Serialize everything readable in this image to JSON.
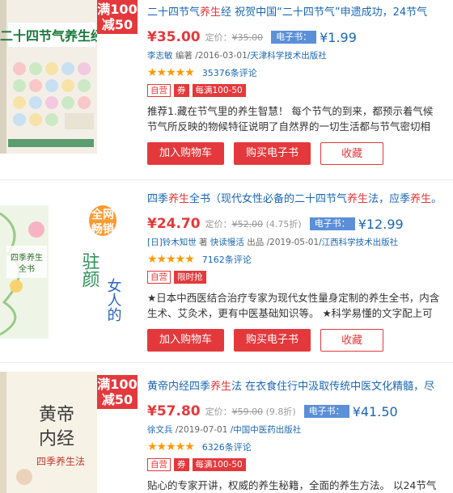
{
  "items": [
    {
      "promo": [
        "满100",
        "减50"
      ],
      "title_parts": [
        "二十四节气",
        "养生",
        "经  祝贺中国“二十四节气”申遗成功，24节气"
      ],
      "price": "¥35.00",
      "orig_label": "定价：",
      "orig_price": "¥35.00",
      "discount": "",
      "ebook_label": "电子书：",
      "ebook_price": "¥1.99",
      "author": "李志敏",
      "role": " 编著 ",
      "date": "/2016-03-01",
      "publisher": "/天津科学技术出版社",
      "stars": "★★★★★",
      "reviews": "35376条评论",
      "tags": [
        "自营",
        "券",
        "每满100-50"
      ],
      "desc": [
        "推荐1.藏在节气里的养生智慧！ 每个节气的到来，都预示着气候",
        "节气所反映的物候特征说明了自然界的一切生活都与节气密切相"
      ],
      "buttons": {
        "cart": "加入购物车",
        "ebook": "购买电子书",
        "fav": "收藏"
      },
      "cover_title": "二十四节气养生经"
    },
    {
      "promo_badge": [
        "全网",
        "畅销"
      ],
      "title_parts": [
        "四季",
        "养生",
        "全书（现代女性必备的二十四节气",
        "养生",
        "法，应季",
        "养生",
        "。"
      ],
      "price": "¥24.70",
      "orig_label": "定价：",
      "orig_price": "¥52.00",
      "discount": " (4.75折)",
      "ebook_label": "电子书：",
      "ebook_price": "¥12.99",
      "author": "[日]铃木知世",
      "role": " 著 ",
      "author2": "快读慢活",
      "role2": " 出品 ",
      "date": "/2019-05-01",
      "publisher": "/江西科学技术出版社",
      "stars": "★★★★★",
      "reviews": "7162条评论",
      "tags": [
        "自营",
        "限时抢"
      ],
      "desc": [
        "★日本中西医结合治疗专家为现代女性量身定制的养生全书，内含",
        "生术、艾灸术，更有中医基础知识等。 ★科学易懂的文字配上可"
      ],
      "buttons": {
        "cart": "加入购物车",
        "ebook": "购买电子书",
        "fav": "收藏"
      },
      "cover_title": "四季养生全书",
      "cover_side": "女人的驻颜养生术"
    },
    {
      "promo": [
        "满100",
        "减50"
      ],
      "title_parts": [
        "黄帝内经四季",
        "养生",
        "法  在衣食住行中汲取传统中医文化精髓，尽"
      ],
      "price": "¥57.80",
      "orig_label": "定价：",
      "orig_price": "¥59.00",
      "discount": " (9.8折)",
      "ebook_label": "电子书：",
      "ebook_price": "¥41.50",
      "author": "徐文兵",
      "role": "",
      "date": " /2019-07-01",
      "publisher": " /中国中医药出版社",
      "stars": "★★★★★",
      "reviews": "6326条评论",
      "tags": [
        "自营",
        "券",
        "每满100-50"
      ],
      "desc": [
        "贴心的专家开讲，权威的养生秘籍，全面的养生方法。 以24节气"
      ],
      "cover_title": "黄帝内经四季养生法"
    }
  ],
  "colors": {
    "accent": "#e4393c",
    "link": "#1a66b3",
    "star": "#ff9900",
    "ebook_badge": "#5b8fd8"
  }
}
